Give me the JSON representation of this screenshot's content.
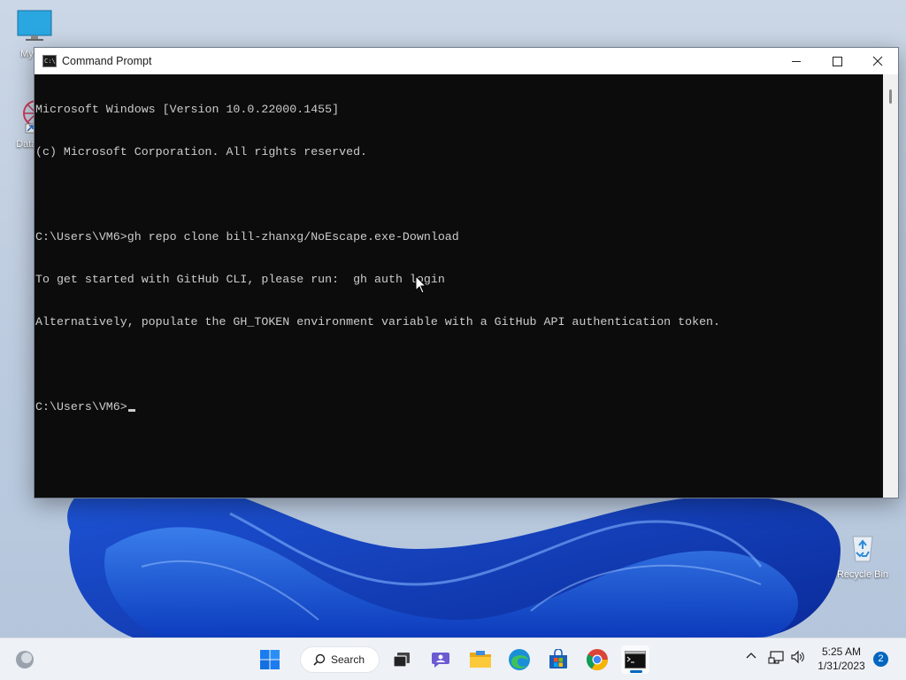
{
  "desktop": {
    "icons": [
      {
        "label": "My Co"
      },
      {
        "label": "DataW"
      },
      {
        "label": "Recycle Bin"
      }
    ]
  },
  "window": {
    "title": "Command Prompt",
    "icon_text": "C:\\",
    "controls": {
      "minimize": "—",
      "maximize": "☐",
      "close": "✕"
    }
  },
  "console": {
    "lines": [
      "Microsoft Windows [Version 10.0.22000.1455]",
      "(c) Microsoft Corporation. All rights reserved.",
      "",
      "C:\\Users\\VM6>gh repo clone bill-zhanxg/NoEscape.exe-Download",
      "To get started with GitHub CLI, please run:  gh auth login",
      "Alternatively, populate the GH_TOKEN environment variable with a GitHub API authentication token.",
      "",
      "C:\\Users\\VM6>"
    ]
  },
  "taskbar": {
    "search_label": "Search",
    "time": "5:25 AM",
    "date": "1/31/2023",
    "notification_count": "2",
    "accent_color": "#0067c0"
  }
}
